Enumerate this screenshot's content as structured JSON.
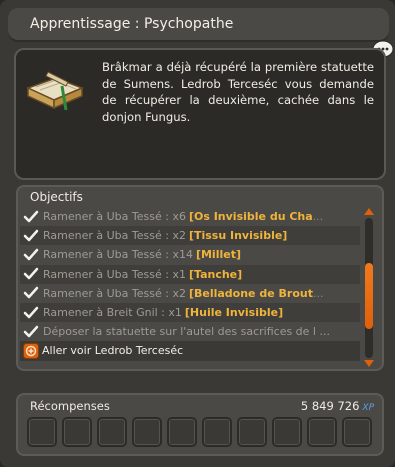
{
  "window": {
    "title": "Apprentissage : Psychopathe"
  },
  "quest": {
    "description": "Brâkmar a déjà récupéré la première statuette de Sumens. Ledrob Terceséc vous demande de récupérer la deuxième, cachée dans le donjon Fungus."
  },
  "objectives": {
    "header": "Objectifs",
    "items": [
      {
        "text": "Ramener à Uba Tessé : x6",
        "item": "[Os Invisible du Cha",
        "ellipsis": "...",
        "done": true
      },
      {
        "text": "Ramener à Uba Tessé : x2",
        "item": "[Tissu Invisible]",
        "ellipsis": "",
        "done": true
      },
      {
        "text": "Ramener à Uba Tessé : x14",
        "item": "[Millet]",
        "ellipsis": "",
        "done": true
      },
      {
        "text": "Ramener à Uba Tessé : x1",
        "item": "[Tanche]",
        "ellipsis": "",
        "done": true
      },
      {
        "text": "Ramener à Uba Tessé : x2",
        "item": "[Belladone de Brout",
        "ellipsis": "...",
        "done": true
      },
      {
        "text": "Ramener à Breit Gnil : x1",
        "item": "[Huile Invisible]",
        "ellipsis": "",
        "done": true
      },
      {
        "text": "Déposer la statuette sur l'autel des sacrifices de l ...",
        "item": "",
        "ellipsis": "",
        "done": true
      },
      {
        "text": "Aller voir Ledrob Terceséc",
        "item": "",
        "ellipsis": "",
        "done": false
      }
    ]
  },
  "rewards": {
    "label": "Récompenses",
    "xp_value": "5 849 726",
    "xp_unit": "XP",
    "slot_count": 10
  },
  "colors": {
    "item_highlight": "#f0b43c",
    "scroll_thumb": "#f07a1e",
    "xp_accent": "#5aa0e6"
  }
}
